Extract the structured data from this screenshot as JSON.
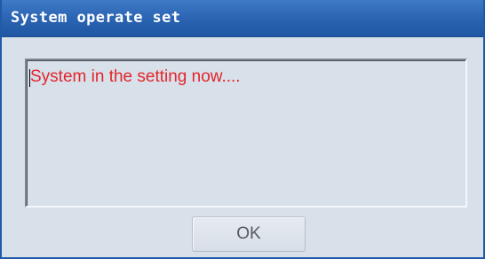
{
  "dialog": {
    "title": "System operate set",
    "message": "System in the setting now....",
    "ok_label": "OK"
  },
  "colors": {
    "titlebar": "#2c66b4",
    "title_text": "#ffffff",
    "dialog_bg": "#d8e0ea",
    "message_text": "#e3262a",
    "button_text": "#555a60"
  }
}
